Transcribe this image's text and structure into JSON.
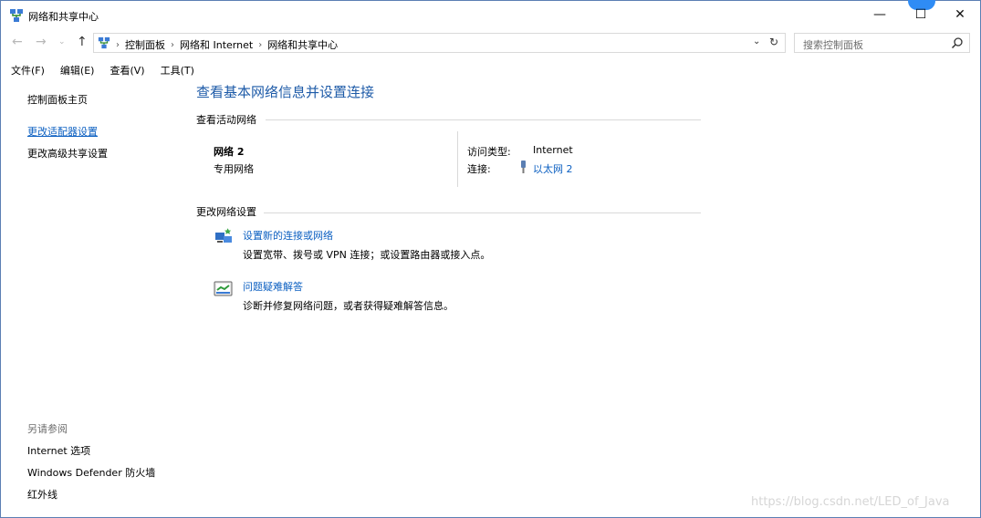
{
  "window": {
    "title": "网络和共享中心",
    "controls": {
      "minimize": "—",
      "maximize": "☐",
      "close": "✕"
    }
  },
  "nav": {
    "back": "←",
    "forward": "→",
    "up": "↑",
    "breadcrumbs": [
      "控制面板",
      "网络和 Internet",
      "网络和共享中心"
    ],
    "search_placeholder": "搜索控制面板"
  },
  "menu": [
    "文件(F)",
    "编辑(E)",
    "查看(V)",
    "工具(T)"
  ],
  "sidebar": {
    "home": "控制面板主页",
    "links": [
      "更改适配器设置",
      "更改高级共享设置"
    ],
    "see_also_title": "另请参阅",
    "see_also": [
      "Internet 选项",
      "Windows Defender 防火墙",
      "红外线"
    ]
  },
  "main": {
    "title": "查看基本网络信息并设置连接",
    "active_networks_heading": "查看活动网络",
    "network": {
      "name": "网络 2",
      "category": "专用网络",
      "access_type_label": "访问类型:",
      "access_type_value": "Internet",
      "connection_label": "连接:",
      "connection_value": "以太网 2"
    },
    "change_settings_heading": "更改网络设置",
    "tasks": [
      {
        "link": "设置新的连接或网络",
        "desc": "设置宽带、拨号或 VPN 连接；或设置路由器或接入点。",
        "icon": "new-connection-icon"
      },
      {
        "link": "问题疑难解答",
        "desc": "诊断并修复网络问题，或者获得疑难解答信息。",
        "icon": "troubleshoot-icon"
      }
    ]
  },
  "watermark": "https://blog.csdn.net/LED_of_Java",
  "colors": {
    "link": "#0b5fc1",
    "title": "#1e5ba8",
    "border": "#5b7fb3"
  }
}
